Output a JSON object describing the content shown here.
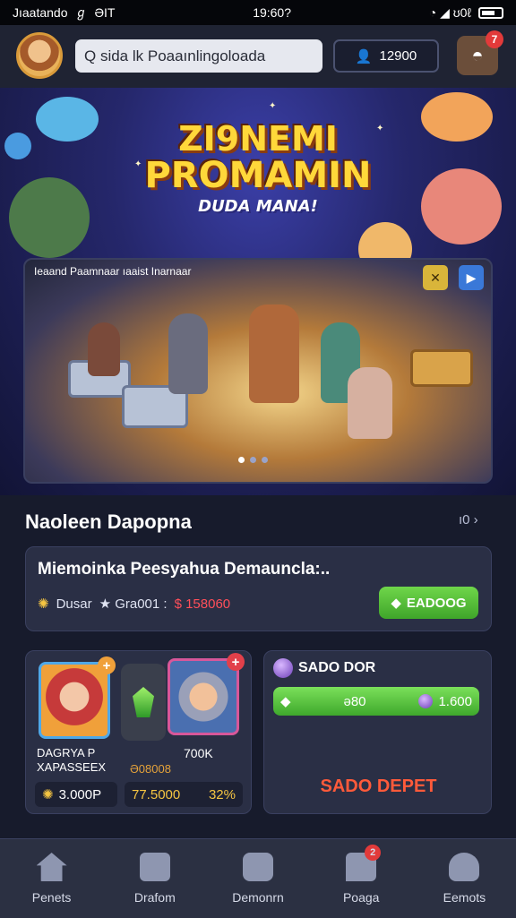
{
  "status_bar": {
    "carrier": "Jıaatando",
    "wifi": "ℊ",
    "network": "ƏIT",
    "time": "19:60?",
    "right_icons": "◔ ◢ ʊ0ℓ"
  },
  "header": {
    "search_text": "Q sida lk Poaaınlingoloada",
    "coins": "12900",
    "notification_count": "7"
  },
  "hero": {
    "title_line1": "ZI9NEMI",
    "title_line2": "PROMAMIN",
    "subtitle": "DUDA MANA!",
    "banner_caption": "Ieaand Paamnaar ıaaist Inarnaar",
    "controls": [
      "✕",
      "▶"
    ]
  },
  "section": {
    "title": "Naoleen Dapopna",
    "more": "ı0 ›"
  },
  "offer": {
    "title": "Miemoinka Peesyahua Demauncla:..",
    "meta1": "Dusar",
    "meta2": "★ Gra001 :",
    "price": "$ 158060",
    "button": "EADOOG"
  },
  "bundle": {
    "label1": "DAGRYA P",
    "label1b": "XAPASSEEX",
    "label2": "700K",
    "label3": "Ə08008",
    "pill1": "3.000P",
    "pill2_a": "77.5000",
    "pill2_b": "32%"
  },
  "deposit": {
    "title": "SADO DOR",
    "bar_value": "ə80",
    "bar_amount": "1.600",
    "cta": "SADO DEPET"
  },
  "nav": {
    "items": [
      {
        "label": "Penets"
      },
      {
        "label": "Drafom"
      },
      {
        "label": "Demonrn"
      },
      {
        "label": "Poaga",
        "badge": "2"
      },
      {
        "label": "Eemots"
      }
    ]
  },
  "colors": {
    "accent_green": "#4fbf34",
    "price_red": "#ff4f5a",
    "title_gold": "#ffd83a",
    "background": "#171b2c"
  }
}
